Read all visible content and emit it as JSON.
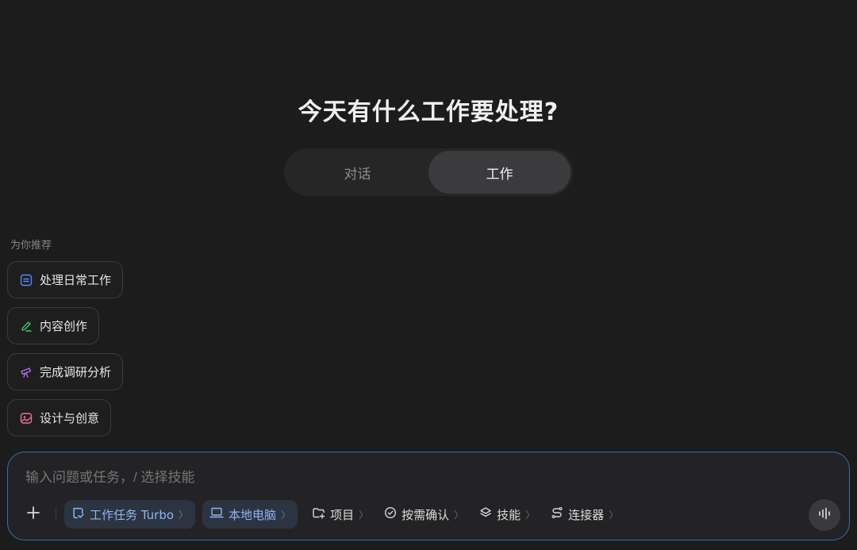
{
  "heading": "今天有什么工作要处理?",
  "mode_tabs": [
    {
      "label": "对话",
      "active": false
    },
    {
      "label": "工作",
      "active": true
    }
  ],
  "recommend": {
    "label": "为你推荐",
    "items": [
      {
        "label": "处理日常工作",
        "icon": "task-list-icon",
        "color": "#4f8ff7"
      },
      {
        "label": "内容创作",
        "icon": "pen-icon",
        "color": "#3ec46d"
      },
      {
        "label": "完成调研分析",
        "icon": "telescope-icon",
        "color": "#b06ef0"
      },
      {
        "label": "设计与创意",
        "icon": "image-icon",
        "color": "#f06ea0"
      }
    ]
  },
  "composer": {
    "placeholder": "输入问题或任务，/ 选择技能",
    "tools": [
      {
        "label": "工作任务 Turbo",
        "icon": "task-check-icon"
      },
      {
        "label": "本地电脑",
        "icon": "laptop-icon"
      },
      {
        "label": "项目",
        "icon": "folder-plus-icon"
      },
      {
        "label": "按需确认",
        "icon": "check-circle-icon"
      },
      {
        "label": "技能",
        "icon": "layers-icon"
      },
      {
        "label": "连接器",
        "icon": "connector-icon"
      }
    ],
    "chevron": "〉"
  }
}
